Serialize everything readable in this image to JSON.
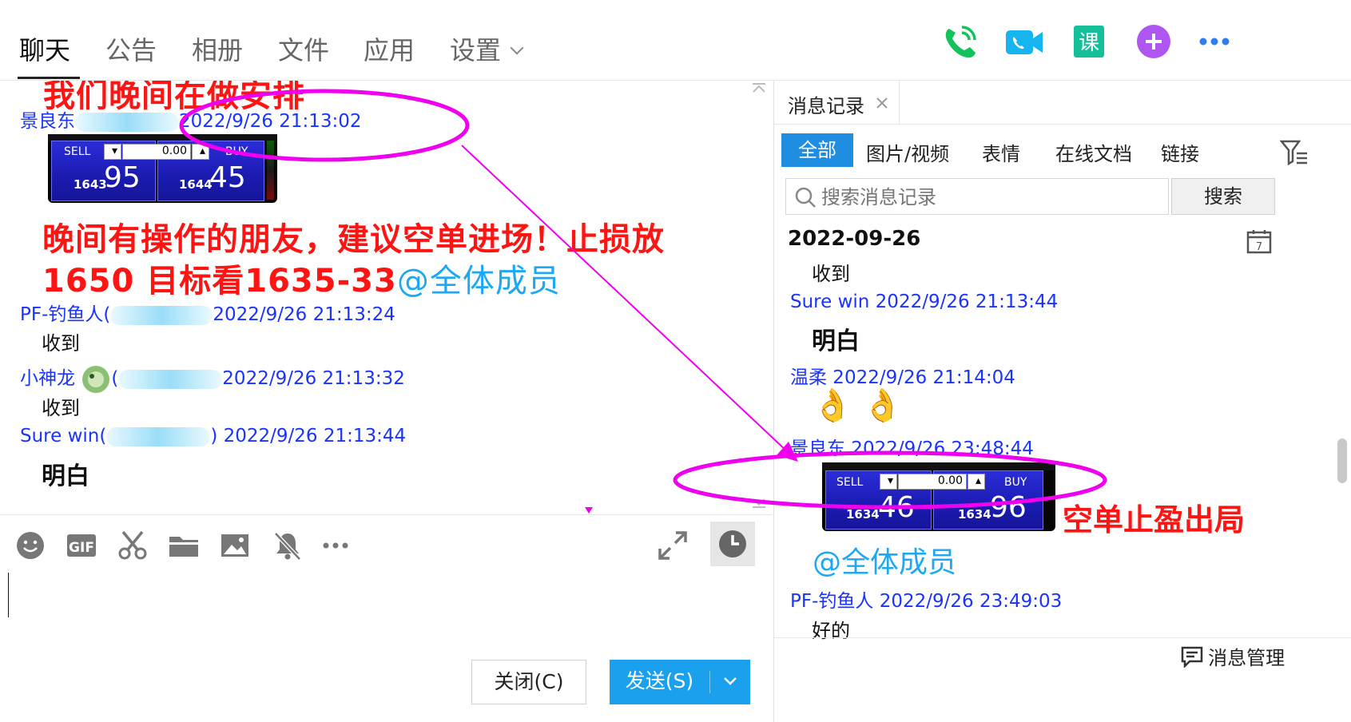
{
  "nav": {
    "tabs": [
      "聊天",
      "公告",
      "相册",
      "文件",
      "应用",
      "设置"
    ],
    "active": "聊天"
  },
  "top_icons": [
    "phone-call-icon",
    "video-call-icon",
    "lesson-icon",
    "add-app-icon",
    "more-icon"
  ],
  "top_icon_text": {
    "lesson": "课"
  },
  "chat": {
    "partial_top_text": "我们晚间在做安排",
    "m1": {
      "sender": "景良东",
      "time": "2022/9/26 21:13:02"
    },
    "trade1": {
      "sell_label": "SELL",
      "buy_label": "BUY",
      "sell_small": "1643",
      "sell_big": "95",
      "buy_small": "1644",
      "buy_big": "45",
      "lot": "0.00"
    },
    "announce_line1": "晚间有操作的朋友，建议空单进场！止损放",
    "announce_line2": "1650  目标看1635-33",
    "mention_all": "@全体成员",
    "m2": {
      "sender": "PF-钓鱼人(",
      "time": "2022/9/26 21:13:24",
      "text": "收到"
    },
    "m3": {
      "sender": "小神龙",
      "paren": "(",
      "time": "2022/9/26 21:13:32",
      "text": "收到"
    },
    "m4": {
      "sender": "Sure win(",
      "time": ") 2022/9/26 21:13:44",
      "text_partial": "明白"
    }
  },
  "toolbar": {
    "icons": [
      "emoji-icon",
      "gif-icon",
      "scissors-icon",
      "folder-icon",
      "image-icon",
      "mute-bell-icon",
      "more-dots-icon",
      "expand-icon",
      "history-clock-icon"
    ],
    "gif_label": "GIF"
  },
  "buttons": {
    "close": "关闭(C)",
    "send": "发送(S)"
  },
  "history": {
    "tab_title": "消息记录",
    "filters": [
      "全部",
      "图片/视频",
      "表情",
      "在线文档",
      "链接"
    ],
    "active_filter": "全部",
    "search_placeholder": "搜索消息记录",
    "search_button": "搜索",
    "date": "2022-09-26",
    "calendar_day": "7",
    "r0": {
      "text": "收到"
    },
    "r1": {
      "sender": "Sure win 2022/9/26 21:13:44",
      "text": "明白"
    },
    "r2": {
      "sender": "温柔 2022/9/26 21:14:04",
      "emoji": "👌 👌"
    },
    "r3": {
      "sender": "景良东 2022/9/26 23:48:44",
      "note": "空单止盈出局",
      "mention": "@全体成员"
    },
    "trade2": {
      "sell_label": "SELL",
      "buy_label": "BUY",
      "sell_small": "1634",
      "sell_big": "46",
      "buy_small": "1634",
      "buy_big": "96",
      "lot": "0.00"
    },
    "r4": {
      "sender": "PF-钓鱼人 2022/9/26 23:49:03",
      "text": "好的"
    },
    "manage": "消息管理"
  },
  "colors": {
    "sender_blue": "#1a33ff",
    "announce_red": "#ff1414",
    "mention_blue": "#1ea7f2",
    "send_button": "#1aa0ec",
    "annotation_magenta": "#ee00ee"
  }
}
